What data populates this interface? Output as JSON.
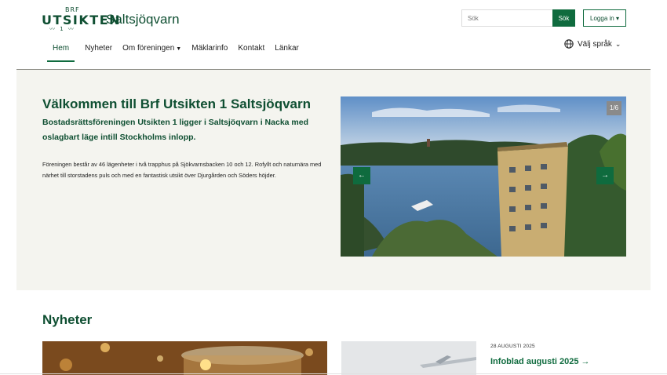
{
  "logo": {
    "brf": "BRF",
    "word": "UTSIKTEN",
    "number": "1",
    "name": "Saltsjöqvarn"
  },
  "search": {
    "placeholder": "Sök",
    "button_label": "Sök"
  },
  "login": {
    "label": "Logga in ▾"
  },
  "nav": {
    "items": [
      {
        "label": "Hem"
      },
      {
        "label": "Nyheter"
      },
      {
        "label": "Om föreningen"
      },
      {
        "label": "Mäklarinfo"
      },
      {
        "label": "Kontakt"
      },
      {
        "label": "Länkar"
      }
    ]
  },
  "language": {
    "label": "Välj språk",
    "icon": "globe-icon"
  },
  "hero": {
    "title": "Välkommen till Brf Utsikten 1 Saltsjöqvarn",
    "lead": "Bostadsrättsföreningen Utsikten 1 ligger i Saltsjöqvarn i Nacka med oslagbart läge intill Stockholms inlopp.",
    "body": "Föreningen består av 46 lägenheter i två trapphus på Sjökvarnsbacken 10 och 12. Rofyllt och naturnära med närhet till storstadens puls och med en fantastisk utsikt över Djurgården och Söders höjder."
  },
  "slider": {
    "counter": "1/6",
    "prev_icon": "arrow-left-icon",
    "next_icon": "arrow-right-icon"
  },
  "news": {
    "title": "Nyheter",
    "items": [
      {
        "date": "28 AUGUSTI 2025",
        "link": "Infoblad augusti 2025 →"
      }
    ]
  },
  "colors": {
    "brand": "#0f4f32",
    "accent": "#0f6b3e",
    "hero_bg": "#f4f4ef"
  }
}
